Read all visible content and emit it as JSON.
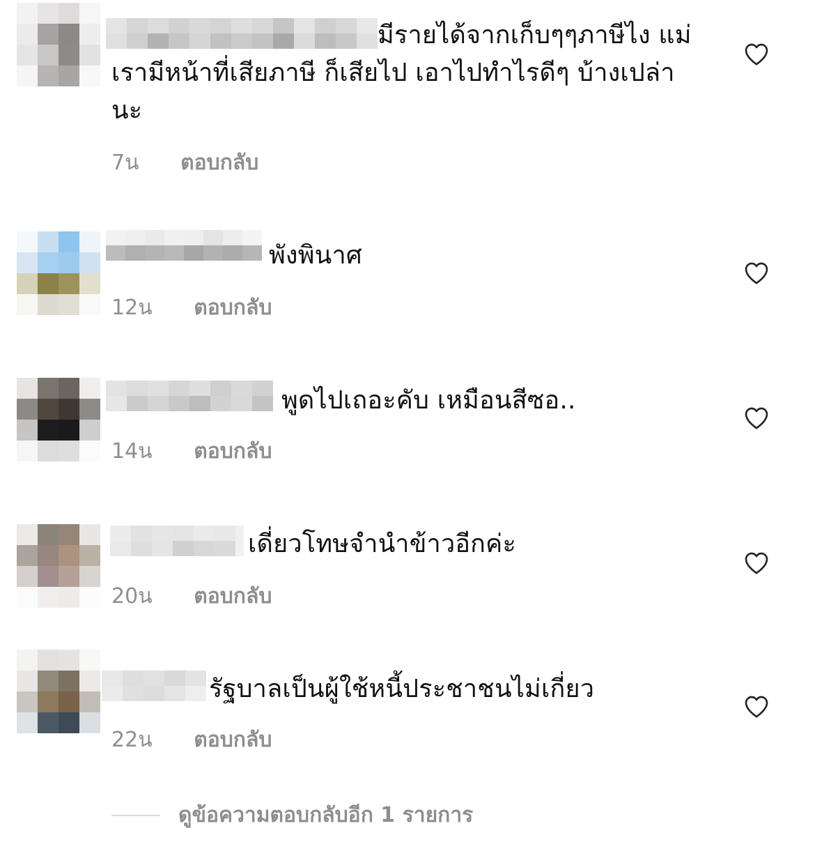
{
  "comments": [
    {
      "text": "มีรายได้จากเก็บๆๆภาษีไง แม่ เรามีหน้าที่เสียภาษี ก็เสียไป เอาไปทำไรดีๆ บ้างเปล่านะ",
      "time": "7น",
      "reply": "ตอบกลับ"
    },
    {
      "text": "พังพินาศ",
      "time": "12น",
      "reply": "ตอบกลับ"
    },
    {
      "text": "พูดไปเถอะคับ เหมือนสีซอ..",
      "time": "14น",
      "reply": "ตอบกลับ"
    },
    {
      "text": "เดี่ยวโทษจำนำข้าวอีกค่ะ",
      "time": "20น",
      "reply": "ตอบกลับ"
    },
    {
      "text": "รัฐบาลเป็นผู้ใช้หนี้ประชาชนไม่เกี่ยว",
      "time": "22น",
      "reply": "ตอบกลับ"
    }
  ],
  "view_more": "ดูข้อความตอบกลับอีก 1 รายการ",
  "colors": {
    "text": "#111111",
    "meta": "#8e8e8e",
    "divider": "#dbdbdb"
  },
  "icons": {
    "like": "heart-outline-icon"
  }
}
